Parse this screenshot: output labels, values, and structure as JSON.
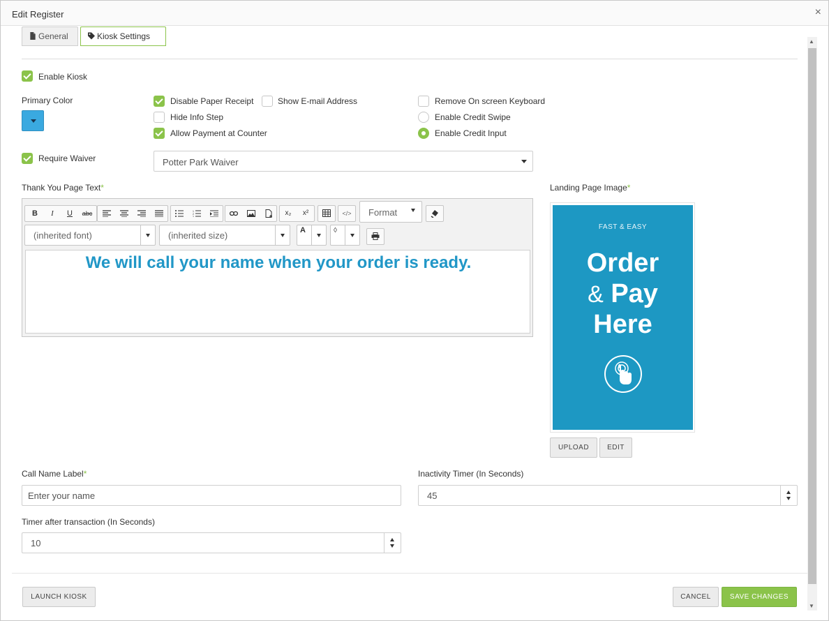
{
  "window": {
    "title": "Edit Register",
    "close_symbol": "×"
  },
  "tabs": [
    {
      "label": "General",
      "icon": "document-icon",
      "active": false
    },
    {
      "label": "Kiosk Settings",
      "icon": "tag-icon",
      "active": true
    }
  ],
  "kiosk": {
    "enable_kiosk": {
      "label": "Enable Kiosk",
      "checked": true
    },
    "primary_color": {
      "label": "Primary Color",
      "value": "#3aa9e0"
    },
    "options": {
      "disable_paper_receipt": {
        "label": "Disable Paper Receipt",
        "checked": true
      },
      "show_email": {
        "label": "Show E-mail Address",
        "checked": false
      },
      "remove_keyboard": {
        "label": "Remove On screen Keyboard",
        "checked": false
      },
      "hide_info_step": {
        "label": "Hide Info Step",
        "checked": false
      },
      "enable_credit_swipe": {
        "label": "Enable Credit Swipe",
        "selected": false
      },
      "allow_payment_counter": {
        "label": "Allow Payment at Counter",
        "checked": true
      },
      "enable_credit_input": {
        "label": "Enable Credit Input",
        "selected": true
      }
    },
    "require_waiver": {
      "label": "Require Waiver",
      "checked": true
    },
    "waiver_select": {
      "value": "Potter Park Waiver"
    },
    "thank_you": {
      "label": "Thank You Page Text",
      "required_mark": "*",
      "toolbar": {
        "bold": "B",
        "italic": "I",
        "underline": "U",
        "strike": "abc",
        "subscript": "x₂",
        "superscript": "x²",
        "source": "</>",
        "format_label": "Format",
        "font_value": "(inherited font)",
        "size_value": "(inherited size)",
        "text_color": "A",
        "bg_color": "◊"
      },
      "content": "We will call your name when your order is ready."
    },
    "landing": {
      "label": "Landing Page Image",
      "required_mark": "*",
      "image": {
        "top_text": "FAST & EASY",
        "line1": "Order",
        "amp": "&",
        "line2": "Pay",
        "line3": "Here"
      },
      "upload_label": "UPLOAD",
      "edit_label": "EDIT"
    },
    "call_name": {
      "label": "Call Name Label",
      "required_mark": "*",
      "placeholder": "Enter your name"
    },
    "inactivity": {
      "label": "Inactivity Timer (In Seconds)",
      "value": "45"
    },
    "after_txn": {
      "label": "Timer after transaction (In Seconds)",
      "value": "10"
    }
  },
  "footer": {
    "launch_label": "LAUNCH KIOSK",
    "cancel_label": "CANCEL",
    "save_label": "SAVE CHANGES"
  },
  "colors": {
    "accent": "#8bc34a",
    "brand_blue": "#1d98c3",
    "text_blue": "#2197c7"
  }
}
